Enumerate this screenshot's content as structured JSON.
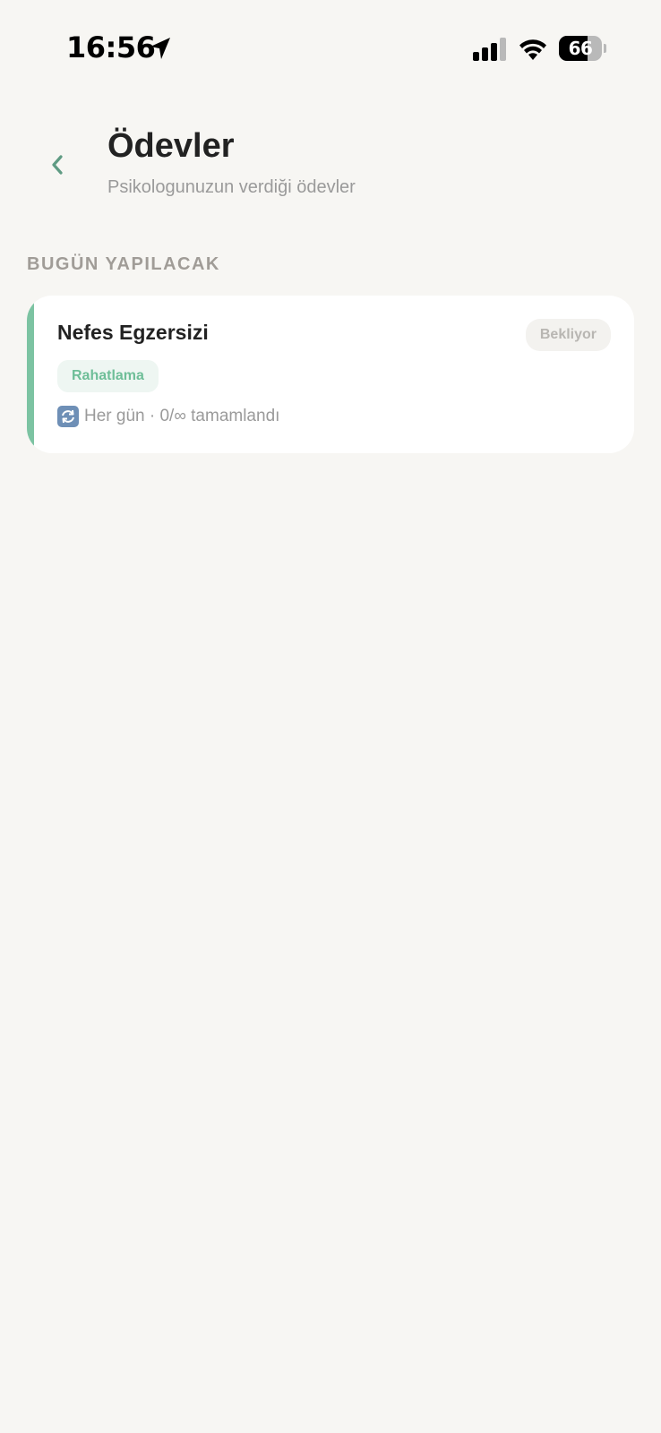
{
  "status_bar": {
    "time": "16:56",
    "battery_level": "66",
    "battery_fraction": 0.66
  },
  "header": {
    "back_icon": "chevron-left-icon",
    "title": "Ödevler",
    "subtitle": "Psikologunuzun verdiği ödevler"
  },
  "section": {
    "title": "BUGÜN YAPILACAK"
  },
  "tasks": [
    {
      "title": "Nefes Egzersizi",
      "status": "Bekliyor",
      "category": "Rahatlama",
      "repeat_icon": "repeat-icon",
      "frequency": "Her gün · 0/∞ tamamlandı"
    }
  ],
  "colors": {
    "accent": "#7CC3A2",
    "back_arrow": "#5F9B83",
    "tag_text": "#6EBE98",
    "tag_bg": "#EEF6F2",
    "background": "#F7F6F3"
  }
}
